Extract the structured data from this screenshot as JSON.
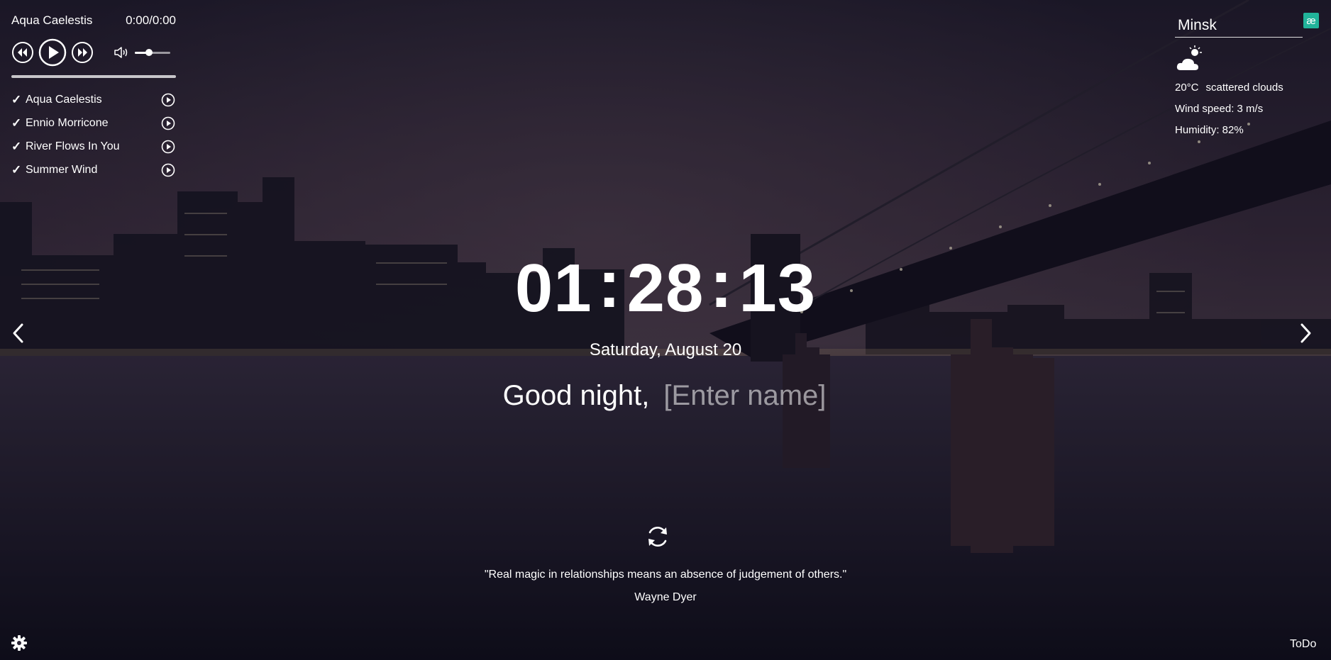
{
  "player": {
    "current_track": "Aqua Caelestis",
    "time": "0:00/0:00",
    "volume": 0.4,
    "progress": 0,
    "tracks": [
      {
        "title": "Aqua Caelestis"
      },
      {
        "title": "Ennio Morricone"
      },
      {
        "title": "River Flows In You"
      },
      {
        "title": "Summer Wind"
      }
    ]
  },
  "weather": {
    "city": "Minsk",
    "temperature": "20°C",
    "description": "scattered clouds",
    "wind": "Wind speed: 3 m/s",
    "humidity": "Humidity: 82%",
    "icon": "cloud-moon-icon"
  },
  "lang_badge": "æ",
  "clock": {
    "hours": "01",
    "minutes": "28",
    "seconds": "13",
    "separator": ":"
  },
  "date": "Saturday, August 20",
  "greeting": {
    "text": "Good night,",
    "name_placeholder": "[Enter name]"
  },
  "quote": {
    "text": "\"Real magic in relationships means an absence of judgement of others.\"",
    "author": "Wayne Dyer"
  },
  "footer": {
    "todo_label": "ToDo"
  },
  "colors": {
    "accent": "#21b39a"
  }
}
